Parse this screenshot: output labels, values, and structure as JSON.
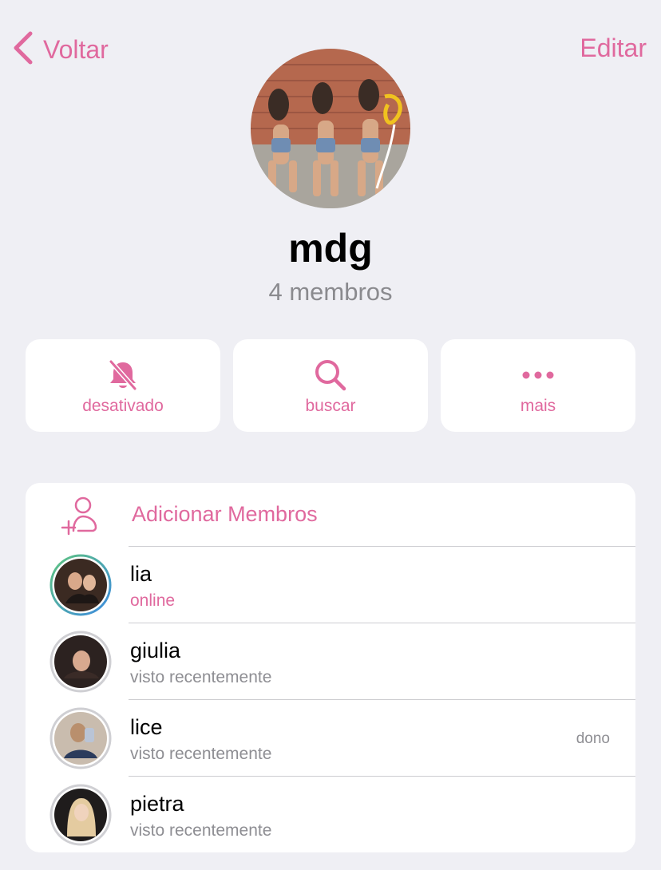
{
  "nav": {
    "back_label": "Voltar",
    "edit_label": "Editar"
  },
  "group": {
    "name": "mdg",
    "member_count": "4 membros"
  },
  "actions": [
    {
      "label": "desativado",
      "icon": "bell-slash-icon"
    },
    {
      "label": "buscar",
      "icon": "magnifier-icon"
    },
    {
      "label": "mais",
      "icon": "more-dots-icon"
    }
  ],
  "add_members": {
    "label": "Adicionar Membros",
    "icon": "add-person-icon"
  },
  "members": [
    {
      "name": "lia",
      "status": "online",
      "role": ""
    },
    {
      "name": "giulia",
      "status": "visto recentemente",
      "role": ""
    },
    {
      "name": "lice",
      "status": "visto recentemente",
      "role": "dono"
    },
    {
      "name": "pietra",
      "status": "visto recentemente",
      "role": ""
    }
  ],
  "colors": {
    "accent": "#e0699e",
    "background": "#efeff4",
    "secondary_text": "#8e8e93"
  }
}
